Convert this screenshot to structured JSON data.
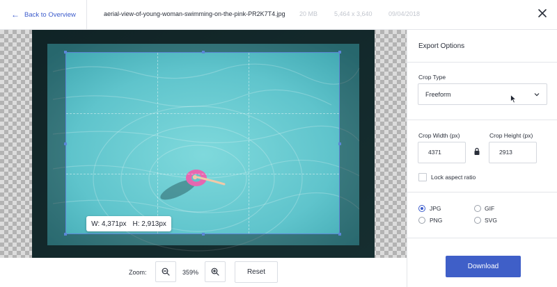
{
  "header": {
    "back_label": "Back to Overview",
    "filename": "aerial-view-of-young-woman-swimming-on-the-pink-PR2K7T4.jpg",
    "file_size": "20 MB",
    "dimensions": "5,464 x 3,640",
    "date": "09/04/2018"
  },
  "canvas": {
    "tooltip_width": "W: 4,371px",
    "tooltip_height": "H: 2,913px"
  },
  "zoom": {
    "label": "Zoom:",
    "value": "359%",
    "reset_label": "Reset"
  },
  "panel": {
    "title": "Export Options",
    "crop_type_label": "Crop Type",
    "crop_type_value": "Freeform",
    "crop_width_label": "Crop Width (px)",
    "crop_width_value": "4371",
    "crop_height_label": "Crop Height (px)",
    "crop_height_value": "2913",
    "lock_label": "Lock aspect ratio",
    "formats": [
      {
        "label": "JPG",
        "selected": true
      },
      {
        "label": "GIF",
        "selected": false
      },
      {
        "label": "PNG",
        "selected": false
      },
      {
        "label": "SVG",
        "selected": false
      }
    ],
    "download_label": "Download"
  },
  "colors": {
    "accent": "#3f5fc8",
    "link": "#3b5bcc",
    "crop_border": "#5b86d6",
    "pool_water": "#5fc4cc"
  },
  "icons": {
    "back": "arrow-left-icon",
    "close": "close-icon",
    "zoom_out": "zoom-out-icon",
    "zoom_in": "zoom-in-icon",
    "select": "chevron-down-icon",
    "lock": "lock-icon"
  }
}
